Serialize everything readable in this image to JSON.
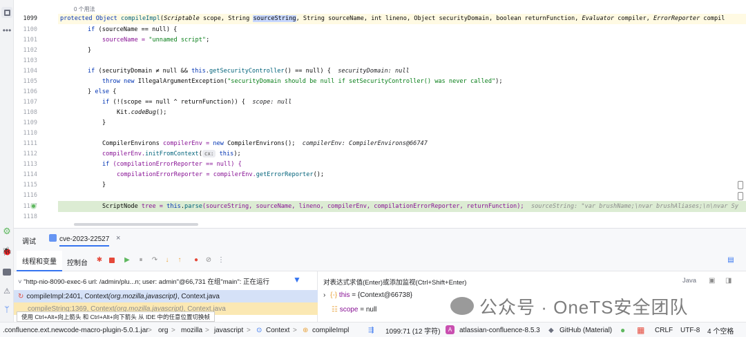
{
  "editor": {
    "usage_hint": "0 个用法",
    "lines": [
      {
        "n": "1099",
        "current": true
      },
      {
        "n": "1100"
      },
      {
        "n": "1101"
      },
      {
        "n": "1102"
      },
      {
        "n": "1103"
      },
      {
        "n": "1104"
      },
      {
        "n": "1105"
      },
      {
        "n": "1106"
      },
      {
        "n": "1107"
      },
      {
        "n": "1108"
      },
      {
        "n": "1109"
      },
      {
        "n": "1110"
      },
      {
        "n": "1111"
      },
      {
        "n": "1112"
      },
      {
        "n": "1113"
      },
      {
        "n": "1114"
      },
      {
        "n": "1115"
      },
      {
        "n": "1116"
      },
      {
        "n": "1117"
      },
      {
        "n": "1118"
      }
    ],
    "code": {
      "l1099_a": "protected ",
      "l1099_b": "Object ",
      "l1099_c": "compileImpl",
      "l1099_d": "(",
      "l1099_e": "Scriptable",
      "l1099_f": " scope, ",
      "l1099_g": "String",
      "l1099_h": " ",
      "l1099_sel": "sourceString",
      "l1099_i": ", String sourceName, int lineno, Object securityDomain, boolean returnFunction, ",
      "l1099_j": "Evaluator",
      "l1099_k": " compiler, ",
      "l1099_l": "ErrorReporter",
      "l1099_m": " compil",
      "l1100_a": "if",
      "l1100_b": " (sourceName == null) {",
      "l1101_a": "sourceName = ",
      "l1101_b": "\"unnamed script\"",
      "l1101_c": ";",
      "l1102": "}",
      "l1104_a": "if",
      "l1104_b": " (securityDomain ≠ null && ",
      "l1104_c": "this",
      "l1104_d": ".",
      "l1104_e": "getSecurityController",
      "l1104_f": "() == null) {",
      "l1104_hint": "securityDomain: null",
      "l1105_a": "throw new ",
      "l1105_b": "IllegalArgumentException",
      "l1105_c": "(",
      "l1105_d": "\"securityDomain should be null if setSecurityController() was never called\"",
      "l1105_e": ");",
      "l1106_a": "} ",
      "l1106_b": "else",
      "l1106_c": " {",
      "l1107_a": "if",
      "l1107_b": " (!(scope == null ^ returnFunction)) {",
      "l1107_hint": "scope: null",
      "l1108_a": "Kit.",
      "l1108_b": "codeBug",
      "l1108_c": "();",
      "l1109": "}",
      "l1111_a": "CompilerEnvirons",
      "l1111_b": " compilerEnv = ",
      "l1111_c": "new ",
      "l1111_d": "CompilerEnvirons",
      "l1111_e": "();",
      "l1111_hint": "compilerEnv: CompilerEnvirons@66747",
      "l1112_a": "compilerEnv.",
      "l1112_b": "initFromContext",
      "l1112_c": "(",
      "l1112_chip": "cx:",
      "l1112_d": " this",
      "l1112_e": ");",
      "l1113_a": "if",
      "l1113_b": " (compilationErrorReporter == null) {",
      "l1114_a": "compilationErrorReporter = compilerEnv.",
      "l1114_b": "getErrorReporter",
      "l1114_c": "();",
      "l1115": "}",
      "l1117_a": "ScriptNode",
      "l1117_b": " tree = ",
      "l1117_c": "this",
      "l1117_d": ".",
      "l1117_e": "parse",
      "l1117_f": "(sourceString, sourceName, lineno, compilerEnv, compilationErrorReporter, returnFunction);",
      "l1117_hint": "sourceString: \"var brushName;\\nvar brushAliases;\\n\\nvar Sy"
    }
  },
  "debug": {
    "tool_title": "调试",
    "session_tab": "cve-2023-22527",
    "close_glyph": "×",
    "tab_threads": "线程和变量",
    "tab_console": "控制台",
    "thread_desc": "\"http-nio-8090-exec-6 url: /admin/plu...n; user: admin\"@66,731 在组\"main\": 正在运行",
    "frames": [
      {
        "method": "compileImpl:2401, Context ",
        "pkg": "(org.mozilla.javascript)",
        "file": ", Context.java"
      },
      {
        "method": "compileString:1369, Context ",
        "pkg": "(org.mozilla.javascript)",
        "file": ", Context.java"
      }
    ],
    "eval_prompt": "对表达式求值(Enter)或添加监视(Ctrl+Shift+Enter)",
    "lang": "Java",
    "vars": [
      {
        "name": "this",
        "value": " = {Context@66738}"
      },
      {
        "name": "scope",
        "value": " = null"
      }
    ],
    "tooltip": "使用 Ctrl+Alt+向上箭头 和 Ctrl+Alt+向下箭头 从 IDE 中的任意位置切换帧"
  },
  "status": {
    "crumbs": [
      ".confluence.ext.newcode-macro-plugin-5.0.1.jar",
      "org",
      "mozilla",
      "javascript",
      "Context",
      "compileImpl"
    ],
    "sep": ">",
    "position": "1099:71 (12 字符)",
    "project": "atlassian-confluence-8.5.3",
    "theme": "GitHub (Material)",
    "line_sep": "CRLF",
    "encoding": "UTF-8",
    "indent": "4 个空格"
  },
  "watermark": "公众号 · OneTS安全团队"
}
